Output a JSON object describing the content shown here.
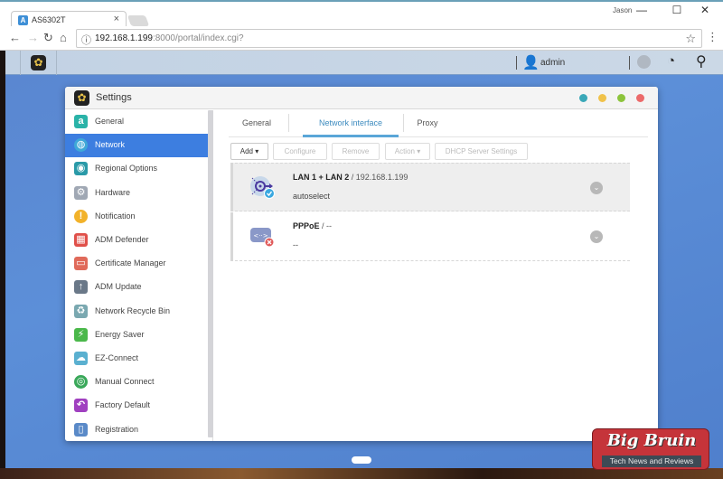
{
  "browser": {
    "tab_title": "AS6302T",
    "tab_favicon": "A",
    "window_user": "Jason",
    "url_host": "192.168.1.199",
    "url_rest": ":8000/portal/index.cgi?",
    "icons": {
      "back": "←",
      "forward": "→",
      "reload": "↻",
      "home": "⌂",
      "info": "ⓘ",
      "star": "☆",
      "menu": "⋮",
      "minimize": "—",
      "maximize": "☐",
      "close": "✕",
      "tab_close": "×"
    }
  },
  "adm_bar": {
    "username": "admin",
    "settings_glyph": "✿",
    "user_glyph": "👤",
    "gauge_glyph": "◔",
    "search_glyph": "⚲"
  },
  "window": {
    "title": "Settings",
    "app_glyph": "✿",
    "dots": [
      {
        "name": "teal",
        "color": "#3aa8b8"
      },
      {
        "name": "yellow",
        "color": "#f0c24a"
      },
      {
        "name": "green",
        "color": "#8cc43c"
      },
      {
        "name": "red",
        "color": "#ec6a6a"
      }
    ]
  },
  "sidebar": {
    "active_index": 1,
    "items": [
      {
        "label": "General",
        "glyph": "a",
        "color": "#2ab3a8"
      },
      {
        "label": "Network",
        "glyph": "◍",
        "color": "#3fa8d8"
      },
      {
        "label": "Regional Options",
        "glyph": "◉",
        "color": "#2a9aa8"
      },
      {
        "label": "Hardware",
        "glyph": "⚙",
        "color": "#a0a8b4"
      },
      {
        "label": "Notification",
        "glyph": "!",
        "color": "#f2b22a"
      },
      {
        "label": "ADM Defender",
        "glyph": "▦",
        "color": "#e0504a"
      },
      {
        "label": "Certificate Manager",
        "glyph": "▭",
        "color": "#e06a5a"
      },
      {
        "label": "ADM Update",
        "glyph": "↑",
        "color": "#6a7888"
      },
      {
        "label": "Network Recycle Bin",
        "glyph": "♻",
        "color": "#7aa8b0"
      },
      {
        "label": "Energy Saver",
        "glyph": "⚡",
        "color": "#4ab84a"
      },
      {
        "label": "EZ-Connect",
        "glyph": "☁",
        "color": "#5ab0d0"
      },
      {
        "label": "Manual Connect",
        "glyph": "◎",
        "color": "#3aa85a"
      },
      {
        "label": "Factory Default",
        "glyph": "↶",
        "color": "#a040c0"
      },
      {
        "label": "Registration",
        "glyph": "▯",
        "color": "#5a8ac8"
      }
    ]
  },
  "content": {
    "tabs": [
      {
        "label": "General",
        "active": false
      },
      {
        "label": "Network interface",
        "active": true
      },
      {
        "label": "Proxy",
        "active": false
      }
    ],
    "toolbar": {
      "add": "Add ▾",
      "configure": "Configure",
      "remove": "Remove",
      "action": "Action ▾",
      "dhcp": "DHCP Server Settings"
    },
    "interfaces": [
      {
        "name": "LAN 1 + LAN 2",
        "separator": " / ",
        "ip": "192.168.1.199",
        "sub": "autoselect",
        "status": "connected",
        "status_glyph": "✓",
        "status_color": "#3aa8e0"
      },
      {
        "name": "PPPoE",
        "separator": " / ",
        "ip": "--",
        "sub": "--",
        "status": "disconnected",
        "status_glyph": "✕",
        "status_color": "#e05a5a"
      }
    ],
    "chevron_glyph": "⌄"
  },
  "watermark": {
    "brand": "Big Bruin",
    "tagline": "Tech News and Reviews"
  }
}
